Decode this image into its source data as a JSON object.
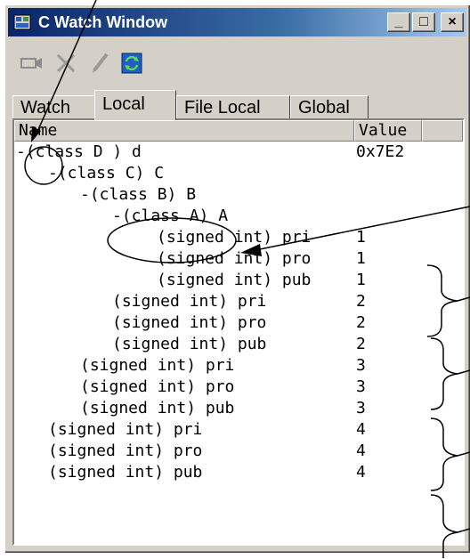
{
  "window": {
    "title": "C Watch Window"
  },
  "title_buttons": {
    "minimize": "_",
    "maximize": "□",
    "close": "×"
  },
  "toolbar": {
    "items": [
      {
        "icon": "add-watch-icon"
      },
      {
        "icon": "delete-icon"
      },
      {
        "icon": "edit-icon"
      },
      {
        "icon": "refresh-icon"
      }
    ]
  },
  "tabs": [
    "Watch",
    "Local",
    "File Local",
    "Global"
  ],
  "active_tab": "Local",
  "columns": {
    "name": "Name",
    "value": "Value"
  },
  "rows": [
    {
      "name": "-(class D ) d",
      "value": "0x7E2",
      "indent": 0
    },
    {
      "name": "-(class C) C",
      "value": "",
      "indent": 1
    },
    {
      "name": "-(class B) B",
      "value": "",
      "indent": 2
    },
    {
      "name": "-(class A) A",
      "value": "",
      "indent": 3
    },
    {
      "name": "(signed int) pri",
      "value": "1",
      "indent": 4
    },
    {
      "name": "(signed int) pro",
      "value": "1",
      "indent": 4
    },
    {
      "name": "(signed int) pub",
      "value": "1",
      "indent": 4
    },
    {
      "name": "(signed int) pri",
      "value": "2",
      "indent": 3
    },
    {
      "name": "(signed int) pro",
      "value": "2",
      "indent": 3
    },
    {
      "name": "(signed int) pub",
      "value": "2",
      "indent": 3
    },
    {
      "name": "(signed int) pri",
      "value": "3",
      "indent": 2
    },
    {
      "name": "(signed int) pro",
      "value": "3",
      "indent": 2
    },
    {
      "name": "(signed int) pub",
      "value": "3",
      "indent": 2
    },
    {
      "name": "(signed int) pri",
      "value": "4",
      "indent": 1
    },
    {
      "name": "(signed int) pro",
      "value": "4",
      "indent": 1
    },
    {
      "name": "(signed int) pub",
      "value": "4",
      "indent": 1
    }
  ],
  "colors": {
    "title_bar": "#0a246a",
    "face": "#d4d0c8",
    "annotation": "#000000"
  }
}
